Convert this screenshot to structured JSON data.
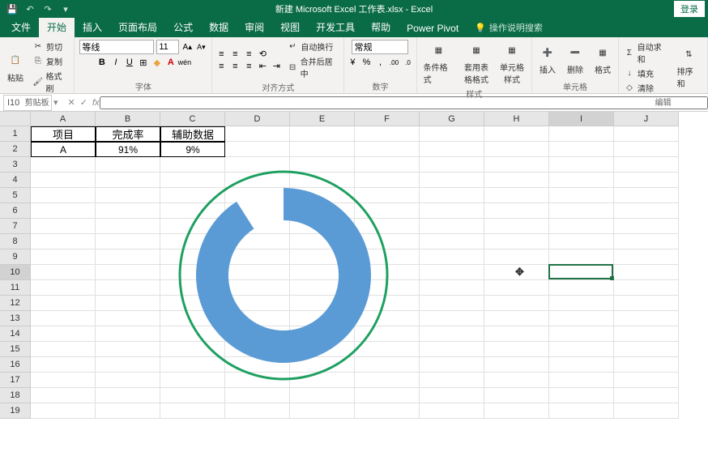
{
  "title": "新建 Microsoft Excel 工作表.xlsx - Excel",
  "login": "登录",
  "tabs": [
    "文件",
    "开始",
    "插入",
    "页面布局",
    "公式",
    "数据",
    "审阅",
    "视图",
    "开发工具",
    "帮助",
    "Power Pivot"
  ],
  "tellme_placeholder": "操作说明搜索",
  "ribbon": {
    "clipboard": {
      "paste": "粘贴",
      "cut": "剪切",
      "copy": "复制",
      "format_painter": "格式刷",
      "label": "剪贴板"
    },
    "font": {
      "name": "等线",
      "size": "11",
      "label": "字体"
    },
    "align": {
      "wrap": "自动换行",
      "merge": "合并后居中",
      "label": "对齐方式"
    },
    "number": {
      "format": "常规",
      "label": "数字"
    },
    "styles": {
      "cond": "条件格式",
      "table": "套用表格格式",
      "cell": "单元格样式",
      "label": "样式"
    },
    "cells": {
      "insert": "插入",
      "delete": "删除",
      "format": "格式",
      "label": "单元格"
    },
    "editing": {
      "sum": "自动求和",
      "fill": "填充",
      "clear": "清除",
      "sort": "排序和",
      "label": "编辑"
    }
  },
  "namebox": "I10",
  "columns": [
    "A",
    "B",
    "C",
    "D",
    "E",
    "F",
    "G",
    "H",
    "I",
    "J"
  ],
  "rows": [
    "1",
    "2",
    "3",
    "4",
    "5",
    "6",
    "7",
    "8",
    "9",
    "10",
    "11",
    "12",
    "13",
    "14",
    "15",
    "16",
    "17",
    "18",
    "19"
  ],
  "table": {
    "r1": {
      "a": "项目",
      "b": "完成率",
      "c": "辅助数据"
    },
    "r2": {
      "a": "A",
      "b": "91%",
      "c": "9%"
    }
  },
  "active_cell": "I10",
  "active_col_index": 8,
  "active_row_index": 9,
  "chart_data": {
    "type": "pie",
    "subtype": "doughnut",
    "categories": [
      "完成率",
      "辅助数据"
    ],
    "values": [
      0.91,
      0.09
    ],
    "hole": 0.63,
    "start_angle": 0,
    "colors": [
      "#5b9bd5",
      "#ffffff"
    ],
    "border": {
      "visible": true,
      "color": "#1ea061",
      "width": 3
    },
    "title": "",
    "xlabel": "",
    "ylabel": ""
  }
}
